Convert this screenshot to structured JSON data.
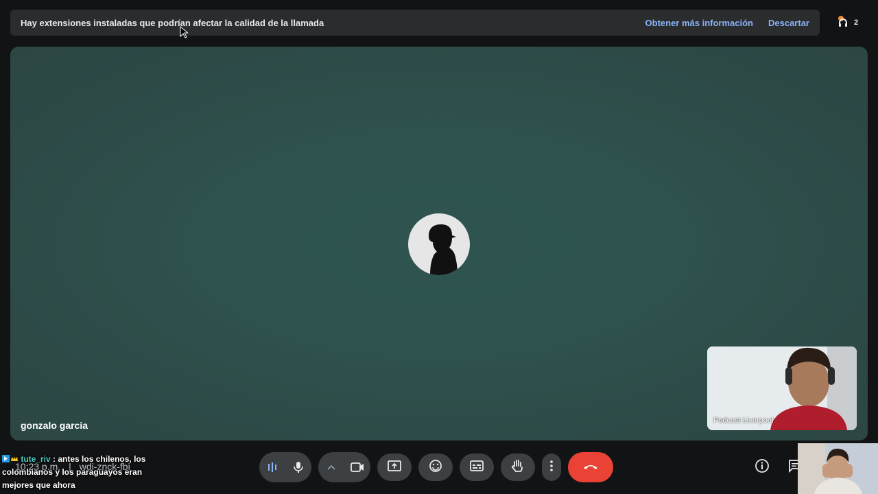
{
  "banner": {
    "message": "Hay extensiones instaladas que podrían afectar la calidad de la llamada",
    "learn_more": "Obtener más información",
    "dismiss": "Descartar"
  },
  "participants_chip": {
    "count": "2"
  },
  "stage": {
    "participant_name": "gonzalo garcia"
  },
  "self_view": {
    "label": "Podcast Liverpool"
  },
  "chat_overlay": {
    "username": "tute_riv",
    "message": ": antes los chilenos, los colombianos y los paraguayos eran mejores que ahora"
  },
  "meeting_info": {
    "time": "10:23 p.m.",
    "separator": "|",
    "code": "wdi-znck-fbi"
  },
  "controls": [
    "audio-levels-icon",
    "microphone-icon",
    "chevron-up-icon",
    "camera-icon",
    "present-screen-icon",
    "emoji-icon",
    "captions-icon",
    "raise-hand-icon",
    "more-options-icon",
    "end-call-icon"
  ],
  "colors": {
    "end_call": "#ea4335",
    "link": "#8ab4f8",
    "stage": "#2e524e"
  }
}
